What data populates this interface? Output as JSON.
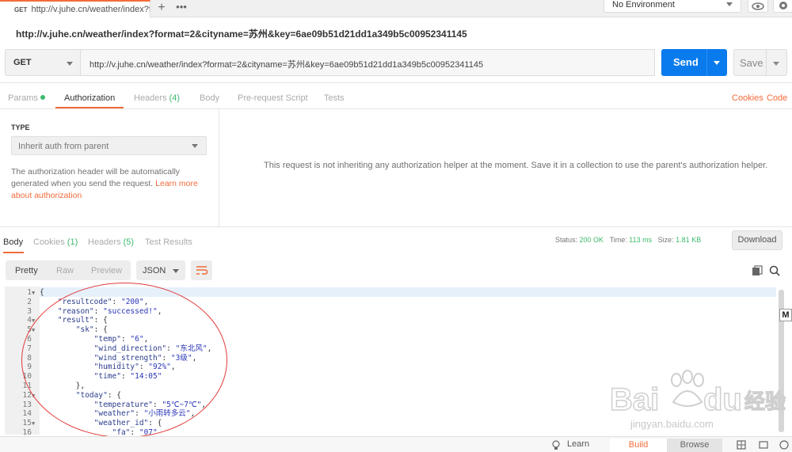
{
  "tab": {
    "method": "GET",
    "title": "http://v.juhe.cn/weather/index?f"
  },
  "header": {
    "environment": "No Environment"
  },
  "request": {
    "url_title": "http://v.juhe.cn/weather/index?format=2&cityname=苏州&key=6ae09b51d21dd1a349b5c00952341145",
    "method": "GET",
    "url": "http://v.juhe.cn/weather/index?format=2&cityname=苏州&key=6ae09b51d21dd1a349b5c00952341145",
    "send_label": "Send",
    "save_label": "Save"
  },
  "request_tabs": {
    "params": "Params",
    "authorization": "Authorization",
    "headers": "Headers",
    "headers_count": "(4)",
    "body": "Body",
    "prerequest": "Pre-request Script",
    "tests": "Tests",
    "cookies": "Cookies",
    "code": "Code"
  },
  "auth": {
    "type_label": "TYPE",
    "type_value": "Inherit auth from parent",
    "desc_1": "The authorization header will be automatically generated when you send the request.",
    "desc_link": "Learn more about authorization",
    "message": "This request is not inheriting any authorization helper at the moment. Save it in a collection to use the parent's authorization helper."
  },
  "response_tabs": {
    "body": "Body",
    "cookies": "Cookies",
    "cookies_count": "(1)",
    "headers": "Headers",
    "headers_count": "(5)",
    "test_results": "Test Results"
  },
  "response_status": {
    "status_label": "Status:",
    "status_value": "200 OK",
    "time_label": "Time:",
    "time_value": "113 ms",
    "size_label": "Size:",
    "size_value": "1.81 KB",
    "download": "Download"
  },
  "view": {
    "pretty": "Pretty",
    "raw": "Raw",
    "preview": "Preview",
    "format": "JSON"
  },
  "code_lines": [
    {
      "n": "1",
      "fold": true,
      "text": "{"
    },
    {
      "n": "2",
      "fold": false,
      "text": "    \"resultcode\": \"200\","
    },
    {
      "n": "3",
      "fold": false,
      "text": "    \"reason\": \"successed!\","
    },
    {
      "n": "4",
      "fold": true,
      "text": "    \"result\": {"
    },
    {
      "n": "5",
      "fold": true,
      "text": "        \"sk\": {"
    },
    {
      "n": "6",
      "fold": false,
      "text": "            \"temp\": \"6\","
    },
    {
      "n": "7",
      "fold": false,
      "text": "            \"wind_direction\": \"东北风\","
    },
    {
      "n": "8",
      "fold": false,
      "text": "            \"wind_strength\": \"3级\","
    },
    {
      "n": "9",
      "fold": false,
      "text": "            \"humidity\": \"92%\","
    },
    {
      "n": "10",
      "fold": false,
      "text": "            \"time\": \"14:05\""
    },
    {
      "n": "11",
      "fold": false,
      "text": "        },"
    },
    {
      "n": "12",
      "fold": true,
      "text": "        \"today\": {"
    },
    {
      "n": "13",
      "fold": false,
      "text": "            \"temperature\": \"5℃~7℃\","
    },
    {
      "n": "14",
      "fold": false,
      "text": "            \"weather\": \"小雨转多云\","
    },
    {
      "n": "15",
      "fold": true,
      "text": "            \"weather_id\": {"
    },
    {
      "n": "16",
      "fold": false,
      "text": "                \"fa\": \"07\""
    }
  ],
  "bottom": {
    "learn": "Learn",
    "build": "Build",
    "browse": "Browse"
  },
  "watermark": {
    "brand": "Baidu经验",
    "url": "jingyan.baidu.com"
  },
  "colors": {
    "accent": "#f26b3a",
    "send": "#097bed",
    "ok": "#3dba6e",
    "annotation": "#e23b3b"
  }
}
